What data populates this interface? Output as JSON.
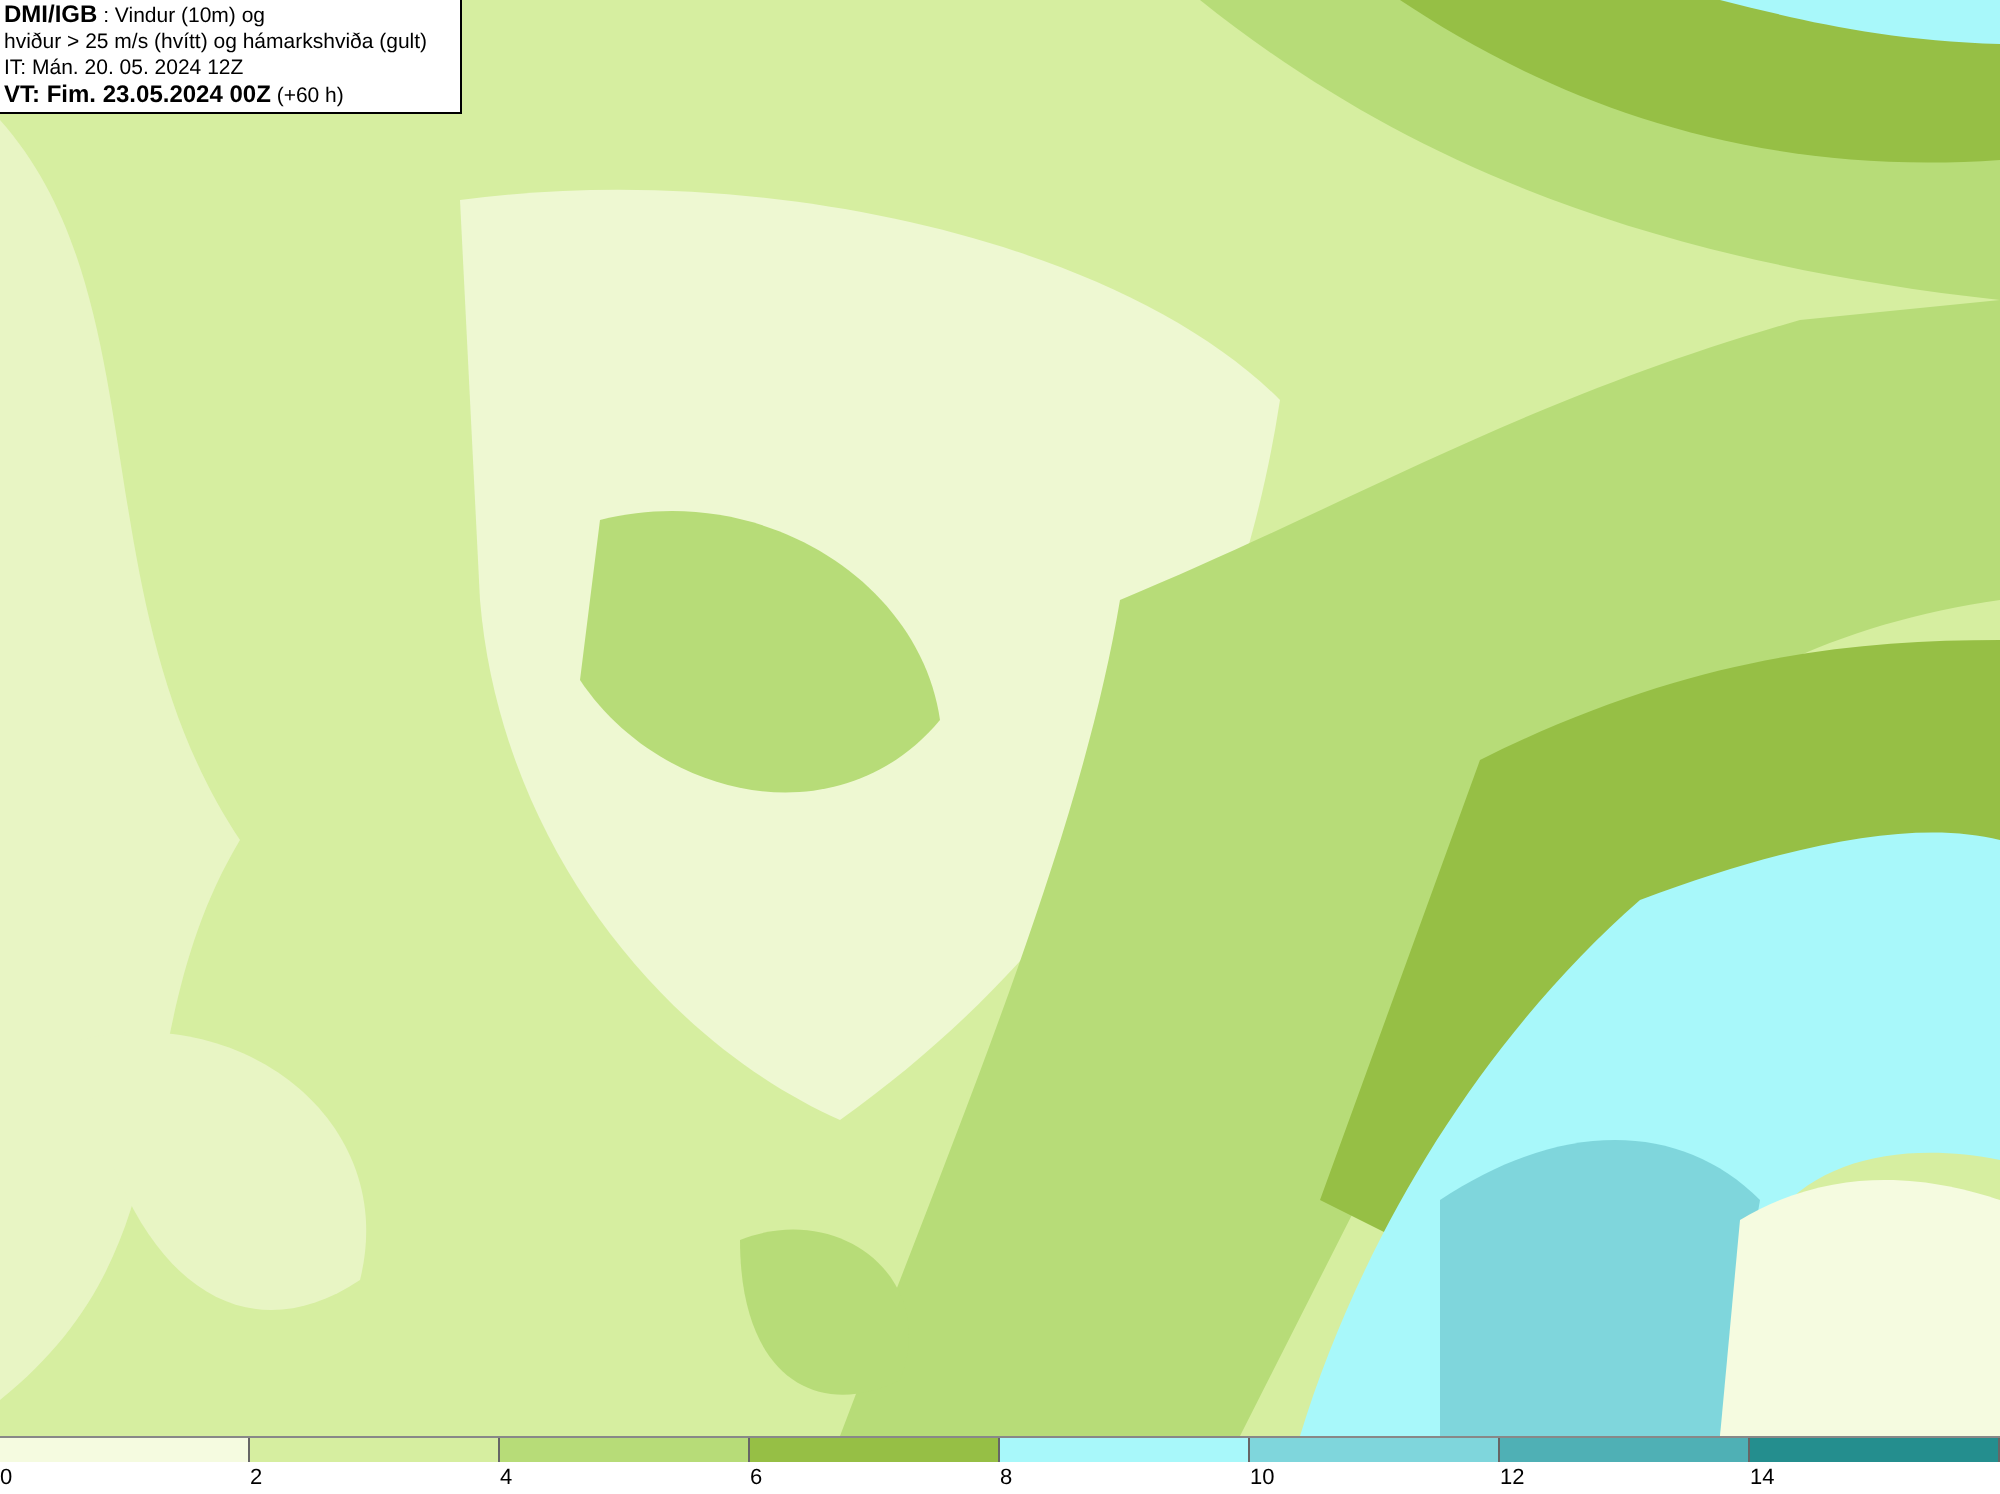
{
  "title_box": {
    "lines": [
      "**DMI/IGB** : Vindur (10m) og",
      "hviður > 25 m/s (hvítt) og hámarkshviða (gult)",
      "IT: Mán. 20. 05. 2024 12Z",
      "**VT: Fim. 23.05.2024 00Z** (+60 h)"
    ]
  },
  "legend": [
    {
      "label": "0",
      "color": "#f5fbe0"
    },
    {
      "label": "2",
      "color": "#d6eea0"
    },
    {
      "label": "4",
      "color": "#b7dc78"
    },
    {
      "label": "6",
      "color": "#96bf45"
    },
    {
      "label": "8",
      "color": "#a8f8fa"
    },
    {
      "label": "10",
      "color": "#7fd6dc"
    },
    {
      "label": "12",
      "color": "#4fb0b5"
    },
    {
      "label": "14",
      "color": "#248e8e"
    }
  ]
}
